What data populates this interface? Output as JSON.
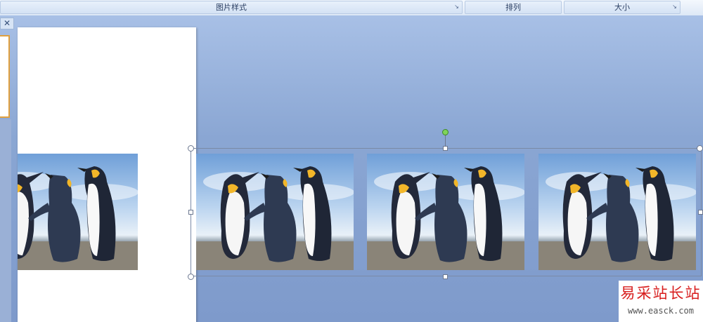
{
  "ribbon": {
    "groups": [
      {
        "label": "图片样式",
        "launcher": "dialog-launcher-icon"
      },
      {
        "label": "排列"
      },
      {
        "label": "大小",
        "launcher": "dialog-launcher-icon"
      }
    ]
  },
  "pane": {
    "close_icon": "close-icon"
  },
  "watermark": {
    "title": "易采站长站",
    "url": "www.easck.com"
  },
  "colors": {
    "workspace": "#8fa9d6",
    "slide": "#ffffff",
    "thumb_border": "#e0a040",
    "rotation_handle": "#7fd35a",
    "watermark_text": "#d81e1e"
  }
}
